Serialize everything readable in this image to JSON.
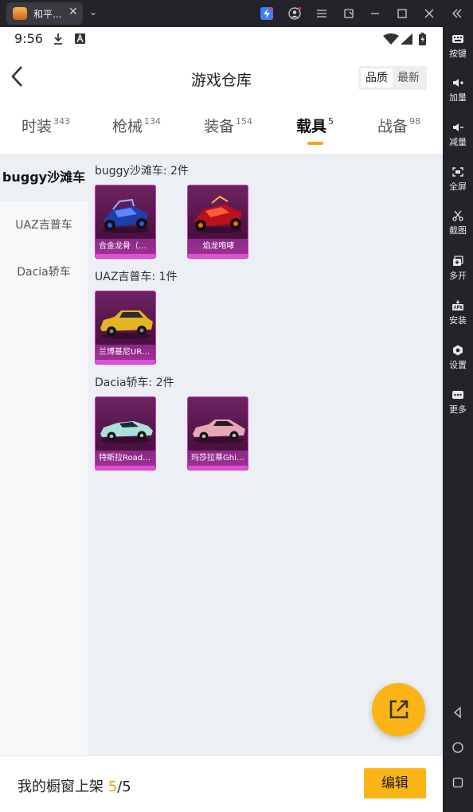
{
  "emulator": {
    "tab_title": "和平...",
    "tab_close": "✕",
    "tab_dropdown": "⌄",
    "sidebar": [
      {
        "label": "按键",
        "icon": "keyboard-icon"
      },
      {
        "label": "加量",
        "icon": "volume-up-icon"
      },
      {
        "label": "减量",
        "icon": "volume-down-icon"
      },
      {
        "label": "全屏",
        "icon": "fullscreen-icon"
      },
      {
        "label": "截图",
        "icon": "scissors-icon"
      },
      {
        "label": "多开",
        "icon": "multi-instance-icon"
      },
      {
        "label": "安装",
        "icon": "apk-install-icon"
      },
      {
        "label": "设置",
        "icon": "gear-icon"
      },
      {
        "label": "更多",
        "icon": "more-icon"
      }
    ]
  },
  "status": {
    "time": "9:56"
  },
  "header": {
    "title": "游戏仓库",
    "back_icon": "‹",
    "sort_options": [
      "品质",
      "最新"
    ],
    "sort_active": 0
  },
  "categories": [
    {
      "label": "时装",
      "count": "343"
    },
    {
      "label": "枪械",
      "count": "134"
    },
    {
      "label": "装备",
      "count": "154"
    },
    {
      "label": "载具",
      "count": "5"
    },
    {
      "label": "战备",
      "count": "98"
    }
  ],
  "active_category": 3,
  "subnav": [
    "buggy沙滩车",
    "UAZ吉普车",
    "Dacia轿车"
  ],
  "groups": [
    {
      "title": "buggy沙滩车: 2件",
      "items": [
        "合金龙骨（蓝...",
        "焰龙咆哮"
      ]
    },
    {
      "title": "UAZ吉普车: 1件",
      "items": [
        "兰博基尼URU..."
      ]
    },
    {
      "title": "Dacia轿车: 2件",
      "items": [
        "特斯拉Roads...",
        "玛莎拉蒂Ghib..."
      ]
    }
  ],
  "bottom": {
    "shelf_label": "我的橱窗上架",
    "shelf_current": "5",
    "shelf_total": "/5",
    "edit_label": "编辑"
  }
}
